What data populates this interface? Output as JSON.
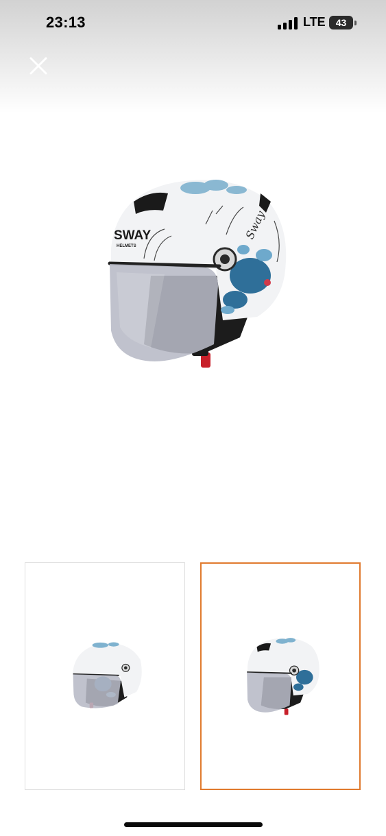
{
  "status_bar": {
    "time": "23:13",
    "network": "LTE",
    "battery_level": "43"
  },
  "viewer": {
    "close_icon": "close-icon",
    "main_image": {
      "brand_text": "SWAY",
      "brand_subtext": "HELMETS",
      "script_text": "Sway"
    },
    "thumbnails": [
      {
        "selected": false
      },
      {
        "selected": true
      }
    ],
    "selected_border_color": "#e07a2e"
  }
}
